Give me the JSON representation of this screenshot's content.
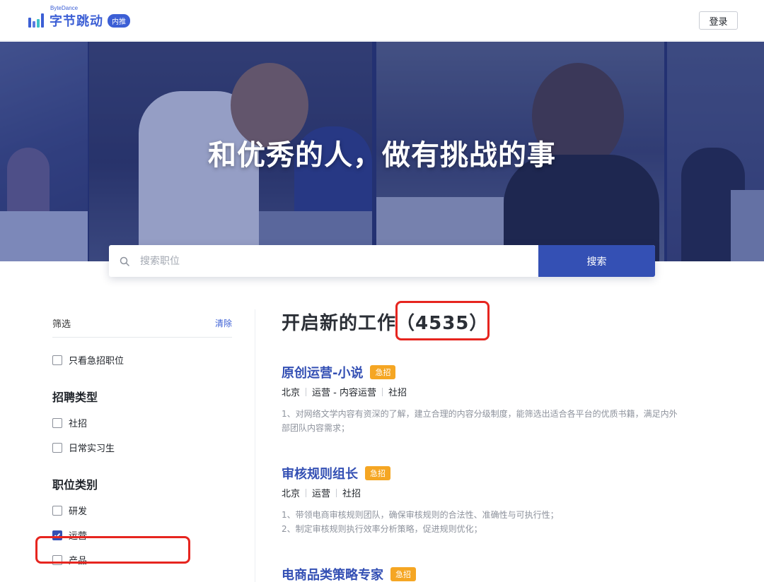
{
  "header": {
    "logo_top": "ByteDance",
    "logo_main": "字节跳动",
    "logo_badge": "内推",
    "login_label": "登录"
  },
  "hero": {
    "title": "和优秀的人，做有挑战的事"
  },
  "search": {
    "placeholder": "搜索职位",
    "button_label": "搜索"
  },
  "filters": {
    "heading": "筛选",
    "clear_label": "清除",
    "urgent_only": {
      "label": "只看急招职位",
      "checked": false
    },
    "groups": [
      {
        "title": "招聘类型",
        "options": [
          {
            "label": "社招",
            "checked": false
          },
          {
            "label": "日常实习生",
            "checked": false
          }
        ]
      },
      {
        "title": "职位类别",
        "options": [
          {
            "label": "研发",
            "checked": false
          },
          {
            "label": "运营",
            "checked": true
          },
          {
            "label": "产品",
            "checked": false
          }
        ]
      }
    ]
  },
  "listing": {
    "title_prefix": "开启新的工作",
    "count_text": "（4535）",
    "jobs": [
      {
        "title": "原创运营-小说",
        "badge": "急招",
        "city": "北京",
        "category": "运营 - 内容运营",
        "type": "社招",
        "desc_lines": [
          "1、对网络文学内容有资深的了解，建立合理的内容分级制度，能筛选出适合各平台的优质书籍，满足内外",
          "部团队内容需求；"
        ]
      },
      {
        "title": "审核规则组长",
        "badge": "急招",
        "city": "北京",
        "category": "运营",
        "type": "社招",
        "desc_lines": [
          "1、带领电商审核规则团队，确保审核规则的合法性、准确性与可执行性；",
          "2、制定审核规则执行效率分析策略，促进规则优化；"
        ]
      },
      {
        "title": "电商品类策略专家",
        "badge": "急招"
      }
    ]
  },
  "colors": {
    "brand": "#3450b4",
    "urgent": "#f5a623",
    "highlight": "#e6251f"
  }
}
